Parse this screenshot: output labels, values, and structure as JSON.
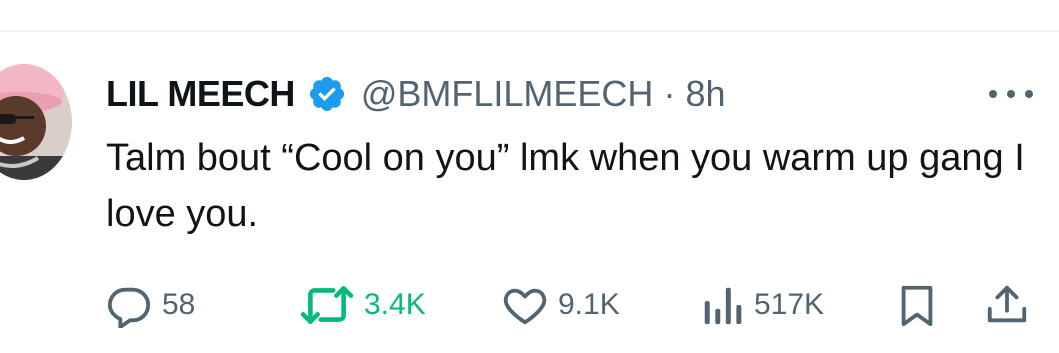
{
  "tweet": {
    "display_name": "LIL MEECH",
    "handle": "@BMFLILMEECH",
    "separator": "·",
    "time": "8h",
    "text": "Talm bout “Cool on you” lmk when you warm up gang I love you.",
    "verified": true
  },
  "actions": {
    "replies": "58",
    "reposts": "3.4K",
    "likes": "9.1K",
    "views": "517K"
  },
  "icons": {
    "verified": "verified-badge-icon",
    "more": "more-options-icon",
    "reply": "reply-icon",
    "repost": "repost-icon",
    "like": "heart-icon",
    "views": "views-chart-icon",
    "bookmark": "bookmark-icon",
    "share": "share-icon"
  },
  "colors": {
    "verified": "#1d9bf0",
    "repost_active": "#00ba7c",
    "secondary_text": "#536471",
    "primary_text": "#0f1419"
  }
}
